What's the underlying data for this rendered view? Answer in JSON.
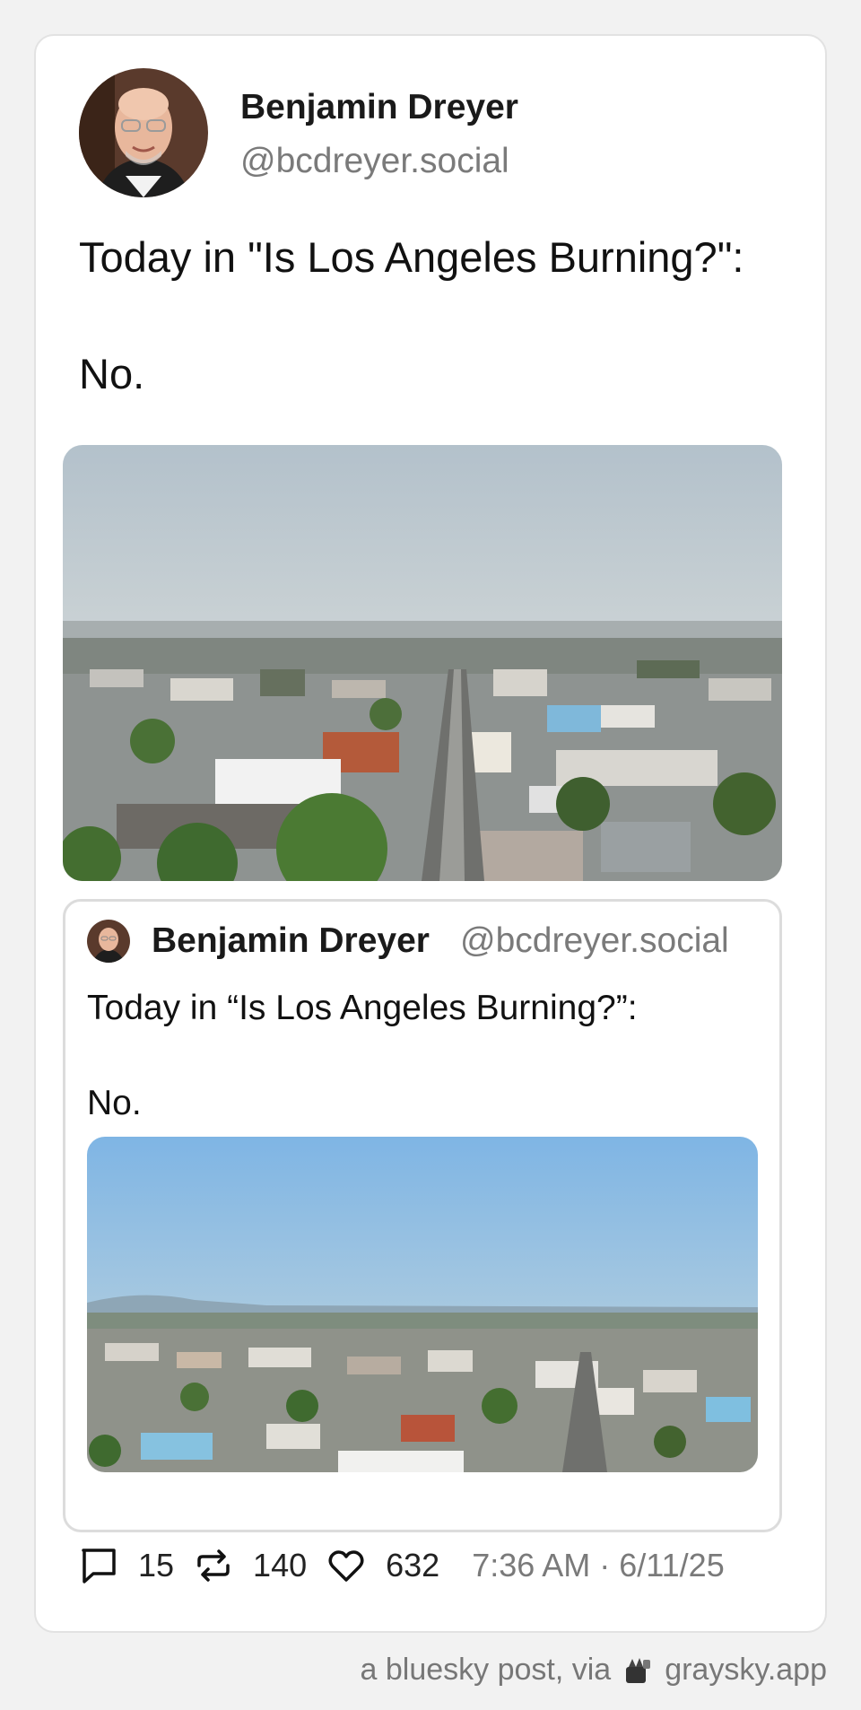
{
  "post": {
    "author_name": "Benjamin Dreyer",
    "author_handle": "@bcdreyer.social",
    "text": "Today in \"Is Los Angeles Burning?\":\n\nNo.",
    "main_image": "aerial-city-photo-hazy"
  },
  "quote": {
    "author_name": "Benjamin Dreyer",
    "author_handle": "@bcdreyer.social",
    "text": "Today in “Is Los Angeles Burning?”:\n\nNo.",
    "image": "aerial-city-photo-clear"
  },
  "stats": {
    "replies": "15",
    "reposts": "140",
    "likes": "632",
    "timestamp": "7:36 AM · 6/11/25"
  },
  "footer": {
    "text": "a bluesky post, via",
    "app": "graysky.app"
  },
  "icons": {
    "reply": "speech-bubble-icon",
    "repost": "repost-arrows-icon",
    "like": "heart-icon",
    "app": "graysky-logo-icon"
  },
  "colors": {
    "background": "#f2f2f2",
    "card": "#ffffff",
    "handle": "#7a7a7a"
  }
}
